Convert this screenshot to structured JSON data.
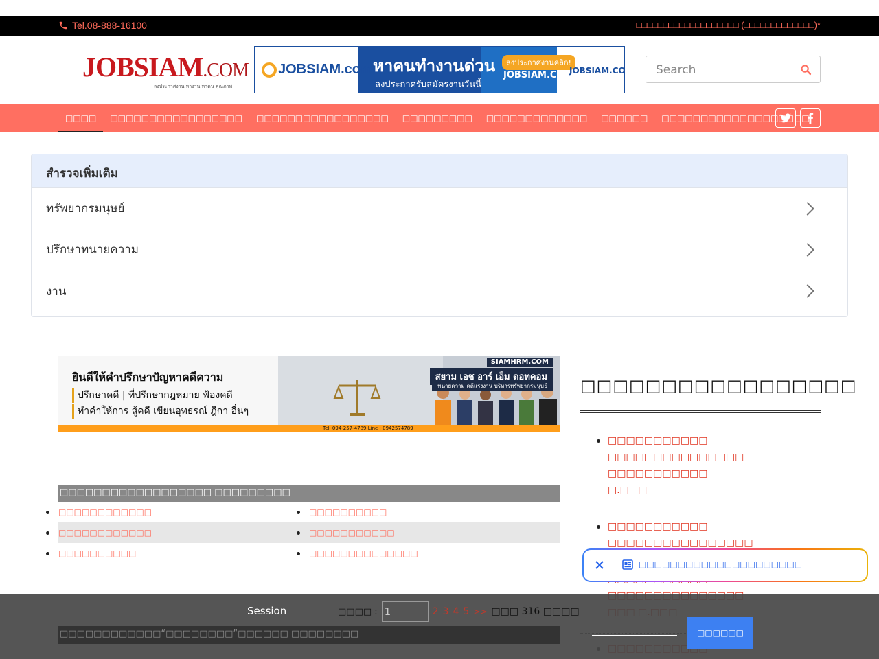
{
  "topbar": {
    "phone": "Tel.08-888-16100",
    "notice": "□□□□□□□□□□□□□□□□□□□ (□□□□□□□□□□□□□)*"
  },
  "logo": {
    "text": "JOBSIAM",
    "suffix": ".COM",
    "tagline": "ลงประกาศงาน หางาน หาคน คุณภาพ"
  },
  "banner": {
    "brand": "JOBSIAM.com",
    "headline": "หาคนทำงานด่วน",
    "subline": "ลงประกาศรับสมัครงานวันนี้",
    "badge": "ลงประกาศงานคลิก!",
    "site": "JOBSIAM.COM",
    "site_right": "JOBSIAM.COM"
  },
  "search": {
    "placeholder": "Search"
  },
  "nav": {
    "items": [
      "□□□□",
      "□□□□□□□□□□□□□□□□□",
      "□□□□□□□□□□□□□□□□□",
      "□□□□□□□□□",
      "□□□□□□□□□□□□□",
      "□□□□□□",
      "□□□□□□□□□□□□□□□□□□□"
    ]
  },
  "survey": {
    "title": "สำรวจเพิ่มเติม",
    "items": [
      "ทรัพยากรมนุษย์",
      "ปรึกษาทนายความ",
      "งาน"
    ]
  },
  "law_banner": {
    "line1": "ยินดีให้คำปรึกษาปัญหาคดีความ",
    "line2": "ปรึกษาคดี | ที่ปรึกษากฎหมาย ฟ้องคดี",
    "line3": "ทำคำให้การ สู้คดี เขียนอุทธรณ์ ฎีกา อื่นๆ",
    "site": "SIAMHRM.COM",
    "brand": "สยาม เอช อาร์ เอ็ม ดอทคอม",
    "brand_sub": "ทนายความ คดีแรงงาน บริหารทรัพยากรมนุษย์",
    "contact": "Tel: 094-257-4789   Line : 0942574789"
  },
  "jobs": {
    "header": "□□□□□□□□□□□□□□□□□□ □□□□□□□□□",
    "rows": [
      [
        "□□□□□□□□□□□□",
        "□□□□□□□□□□"
      ],
      [
        "□□□□□□□□□□□□",
        "□□□□□□□□□□□"
      ],
      [
        "□□□□□□□□□□",
        "□□□□□□□□□□□□□□"
      ]
    ]
  },
  "sidebar": {
    "title": "□□□□□□□□□□□□□□□□□",
    "items": [
      [
        "□□□□□□□□□□□",
        "□□□□□□□□□□□□□□□",
        "□□□□□□□□□□□",
        "□.□□□"
      ],
      [
        "□□□□□□□□□□□",
        "□□□□□□□□□□□□□□□□"
      ],
      [
        "□□□□□□□□□□□",
        "□□□□□□□□□□□□□□□",
        "□□□ □.□□□"
      ],
      [
        "□□□□□□□□□□□"
      ]
    ]
  },
  "session": {
    "label": "Session",
    "page_label": "□□□□ :",
    "page_value": "1",
    "pages": [
      "2",
      "3",
      "4",
      "5"
    ],
    "next": ">>",
    "total": "□□□ 316 □□□□",
    "news_header": "□□□□□□□□□□□□“□□□□□□□□”□□□□□□ □□□□□□□□",
    "ok": "□□□□□□"
  },
  "toast": {
    "text": "□□□□□□□□□□□□□□□□□□□□□"
  },
  "colors": {
    "accent": "#ff6f61",
    "link": "#e0331f",
    "button": "#3d80f2"
  }
}
